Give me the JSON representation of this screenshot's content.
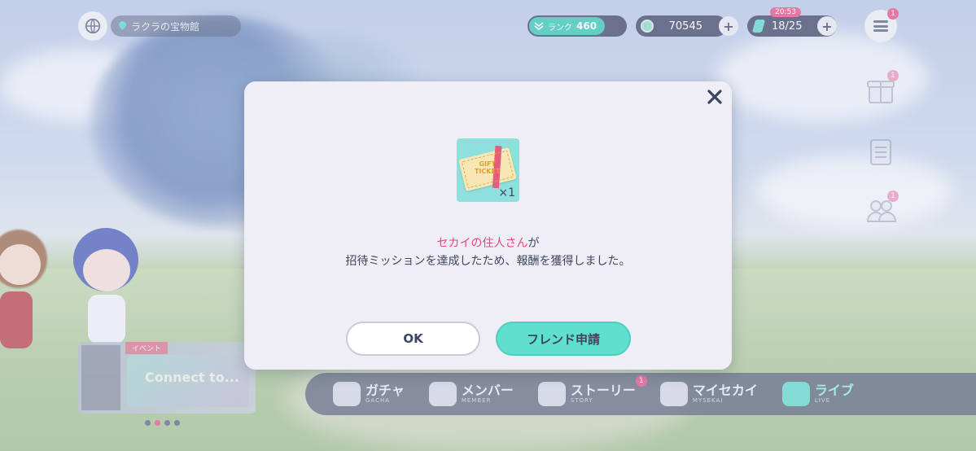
{
  "hud": {
    "location": "ラクラの宝物館",
    "rank_label": "ランク",
    "rank_value": "460",
    "coins": "70545",
    "stamina": "18/25",
    "stamina_timer": "20:53",
    "menu_badge": "1"
  },
  "side_icons": [
    {
      "name": "gift-box-icon",
      "badge": "1"
    },
    {
      "name": "mission-list-icon",
      "badge": ""
    },
    {
      "name": "friends-icon",
      "badge": "1"
    }
  ],
  "event": {
    "tag": "イベント",
    "art_text": "Connect to..."
  },
  "bottom_nav": [
    {
      "label": "ガチャ",
      "sub": "GACHA",
      "badge": ""
    },
    {
      "label": "メンバー",
      "sub": "MEMBER",
      "badge": ""
    },
    {
      "label": "ストーリー",
      "sub": "STORY",
      "badge": "1"
    },
    {
      "label": "マイセカイ",
      "sub": "MYSEKAI",
      "badge": ""
    },
    {
      "label": "ライブ",
      "sub": "LIVE",
      "badge": ""
    }
  ],
  "dialog": {
    "reward": {
      "ticket_line1": "GIFT",
      "ticket_line2": "TICKET",
      "quantity": "×1"
    },
    "message": {
      "name": "セカイの住人さん",
      "name_suffix": "が",
      "line2": "招待ミッションを達成したため、報酬を獲得しました。"
    },
    "ok_label": "OK",
    "friend_label": "フレンド申請"
  },
  "colors": {
    "accent": "#5fe0cf",
    "name_pink": "#e8477c",
    "badge": "#e94f86"
  }
}
